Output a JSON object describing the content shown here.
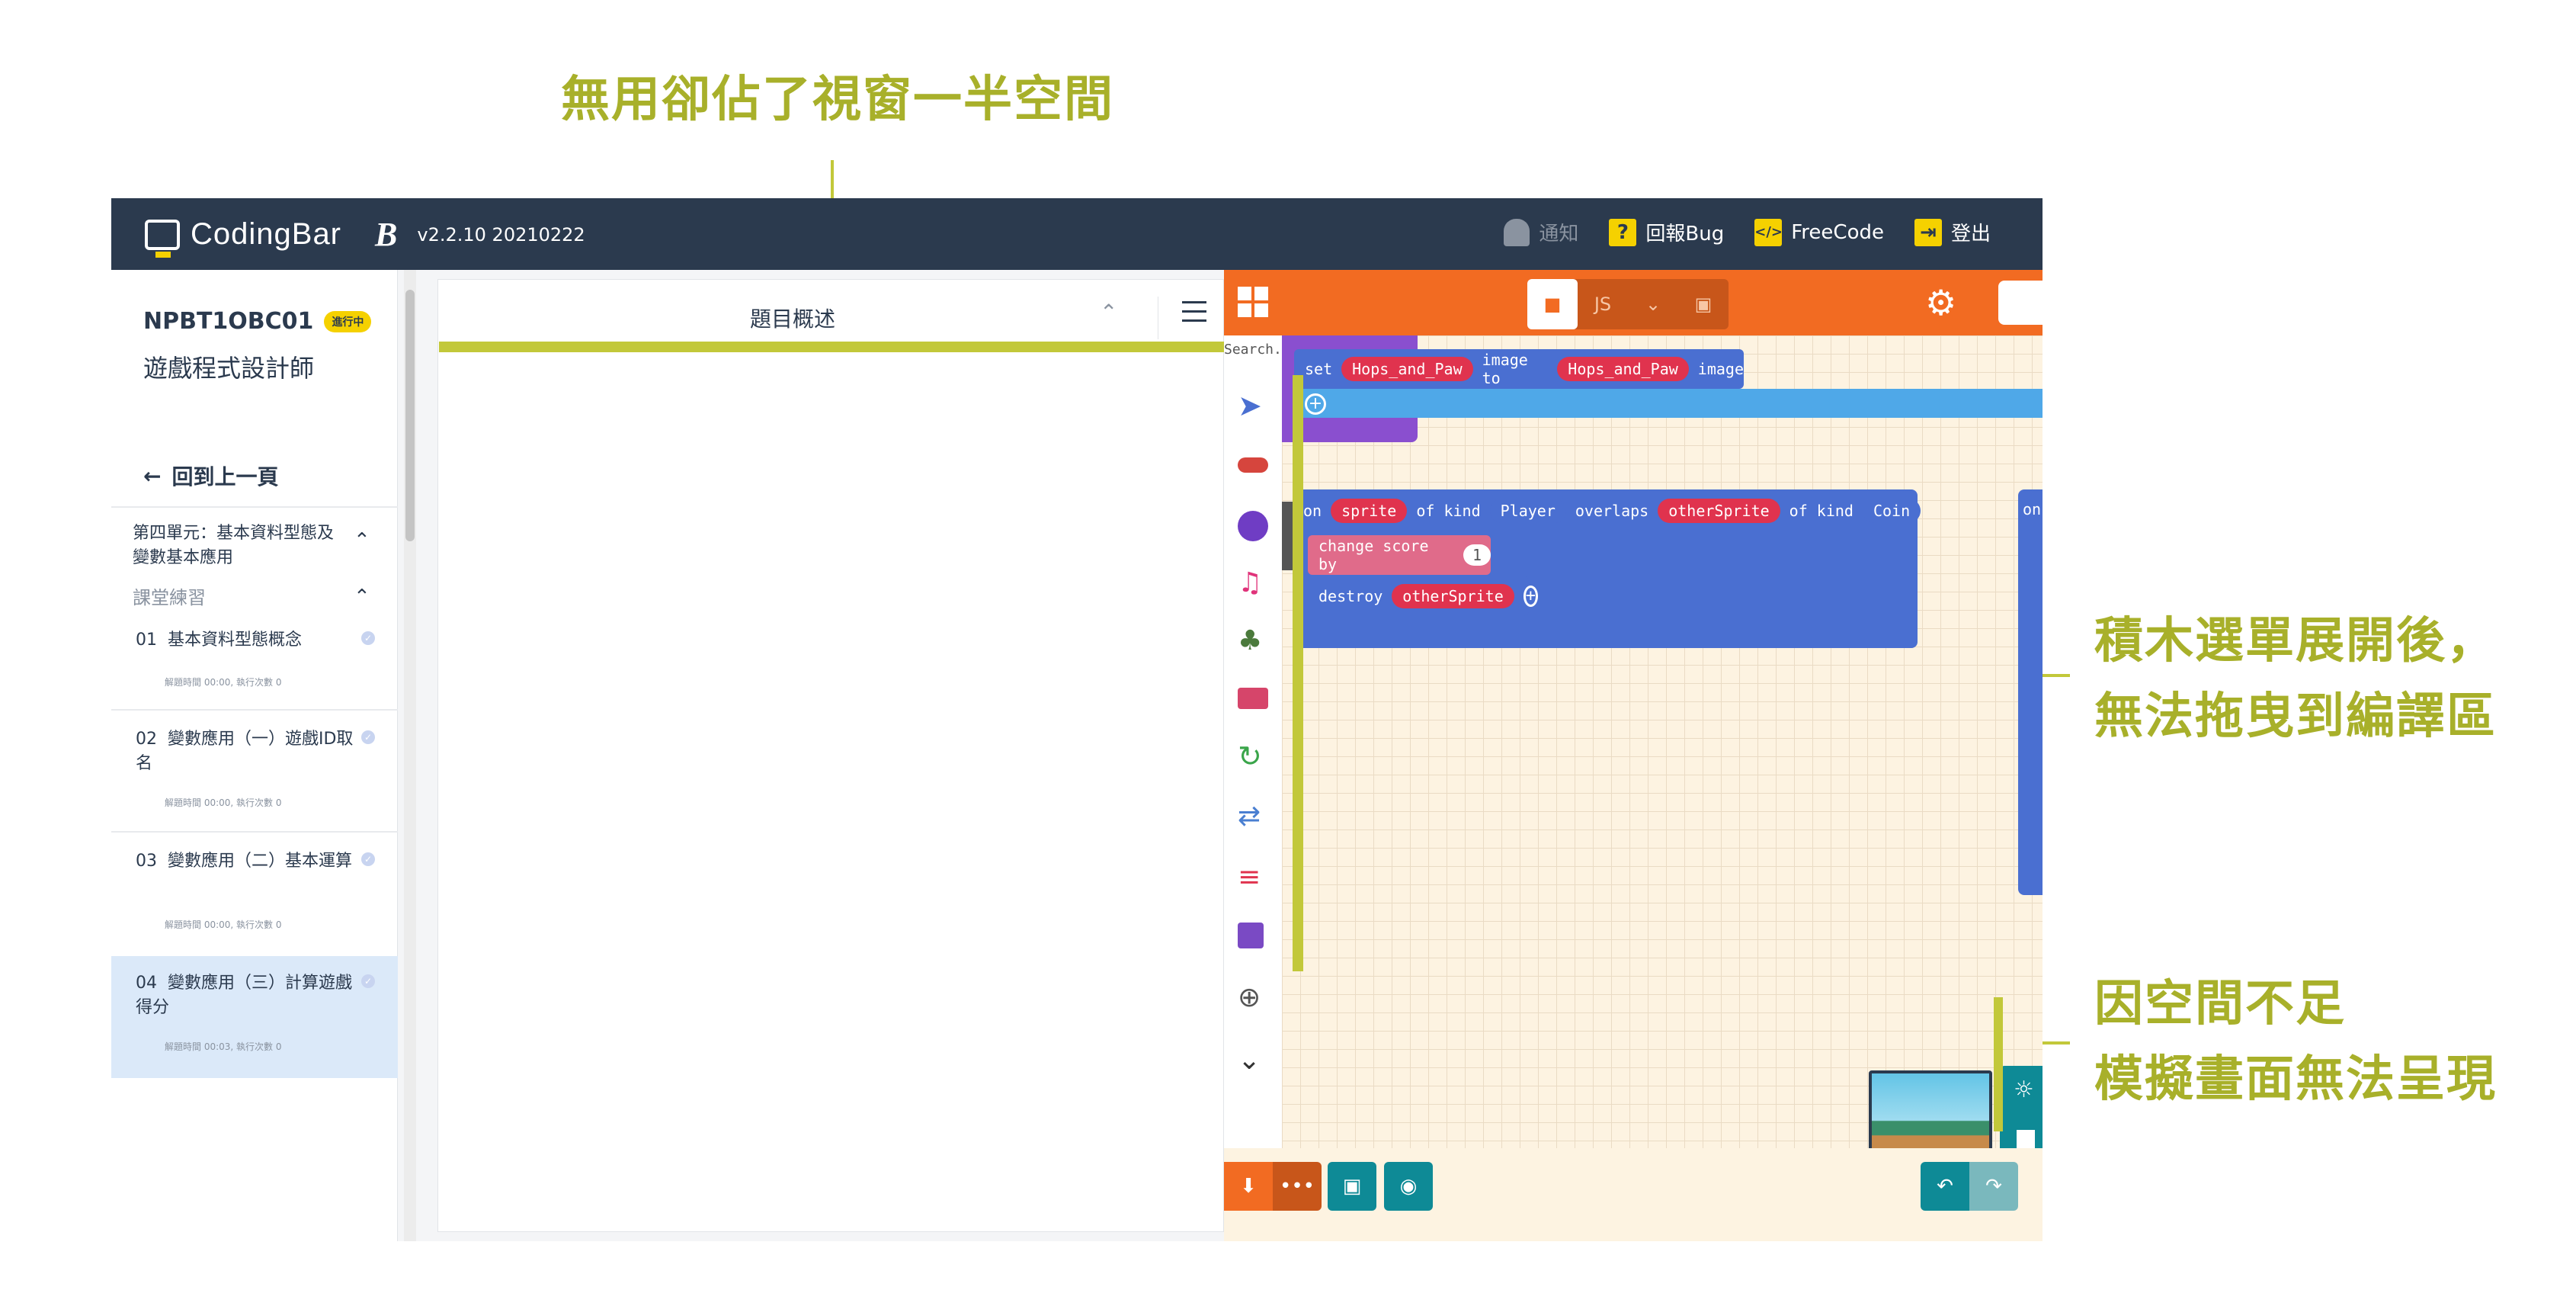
{
  "annotations": {
    "top": "無用卻佔了視窗一半空間",
    "right_middle_line1": "積木選單展開後，",
    "right_middle_line2": "無法拖曳到編譯區",
    "right_bottom_line1": "因空間不足",
    "right_bottom_line2": "模擬畫面無法呈現",
    "color": "#a8b02a"
  },
  "topbar": {
    "brand": "CodingBar",
    "brand_mark": "B",
    "version": "v2.2.10 20210222",
    "actions": [
      {
        "label": "通知",
        "icon": "bell-icon"
      },
      {
        "label": "回報Bug",
        "icon": "question-icon"
      },
      {
        "label": "FreeCode",
        "icon": "code-icon"
      },
      {
        "label": "登出",
        "icon": "logout-icon"
      }
    ]
  },
  "sidebar": {
    "course_code": "NPBT1OBC01",
    "status_badge": "進行中",
    "course_title": "遊戲程式設計師",
    "back_label": "回到上一頁",
    "unit_title": "第四單元：基本資料型態及 變數基本應用",
    "section_label": "課堂練習",
    "lessons": [
      {
        "number": "01",
        "title": "基本資料型態概念",
        "meta": "解題時間 00:00, 執行次數 0"
      },
      {
        "number": "02",
        "title": "變數應用（一）遊戲ID取名",
        "meta": "解題時間 00:00, 執行次數 0"
      },
      {
        "number": "03",
        "title": "變數應用（二）基本運算",
        "meta": "解題時間 00:00, 執行次數 0"
      },
      {
        "number": "04",
        "title": "變數應用（三）計算遊戲得分",
        "meta": "解題時間 00:03, 執行次數 0"
      }
    ]
  },
  "middle_panel": {
    "title": "題目概述"
  },
  "editor": {
    "search_placeholder": "Search...",
    "blocks": {
      "set_block": {
        "kw_set": "set",
        "var1": "Hops_and_Paw",
        "kw_image_to": "image to",
        "var2": "Hops_and_Paw",
        "kw_image": "image"
      },
      "overlap_block": {
        "kw_on": "on",
        "sprite": "sprite",
        "kw_of_kind": "of kind",
        "kind1": "Player",
        "kw_overlaps": "overlaps",
        "other": "otherSprite",
        "kw_of_kind2": "of kind",
        "kind2": "Coin"
      },
      "change_block": {
        "label": "change score by",
        "value": "1"
      },
      "destroy_block": {
        "label": "destroy",
        "target": "otherSprite"
      },
      "partial_block": {
        "kw_on": "on"
      }
    },
    "colors": {
      "header": "#f26b22",
      "workspace": "#fdf3e1",
      "block_blue": "#4a6fd1",
      "block_red": "#e0334e",
      "block_pink": "#e06b8a",
      "teal": "#0e8a96"
    }
  }
}
